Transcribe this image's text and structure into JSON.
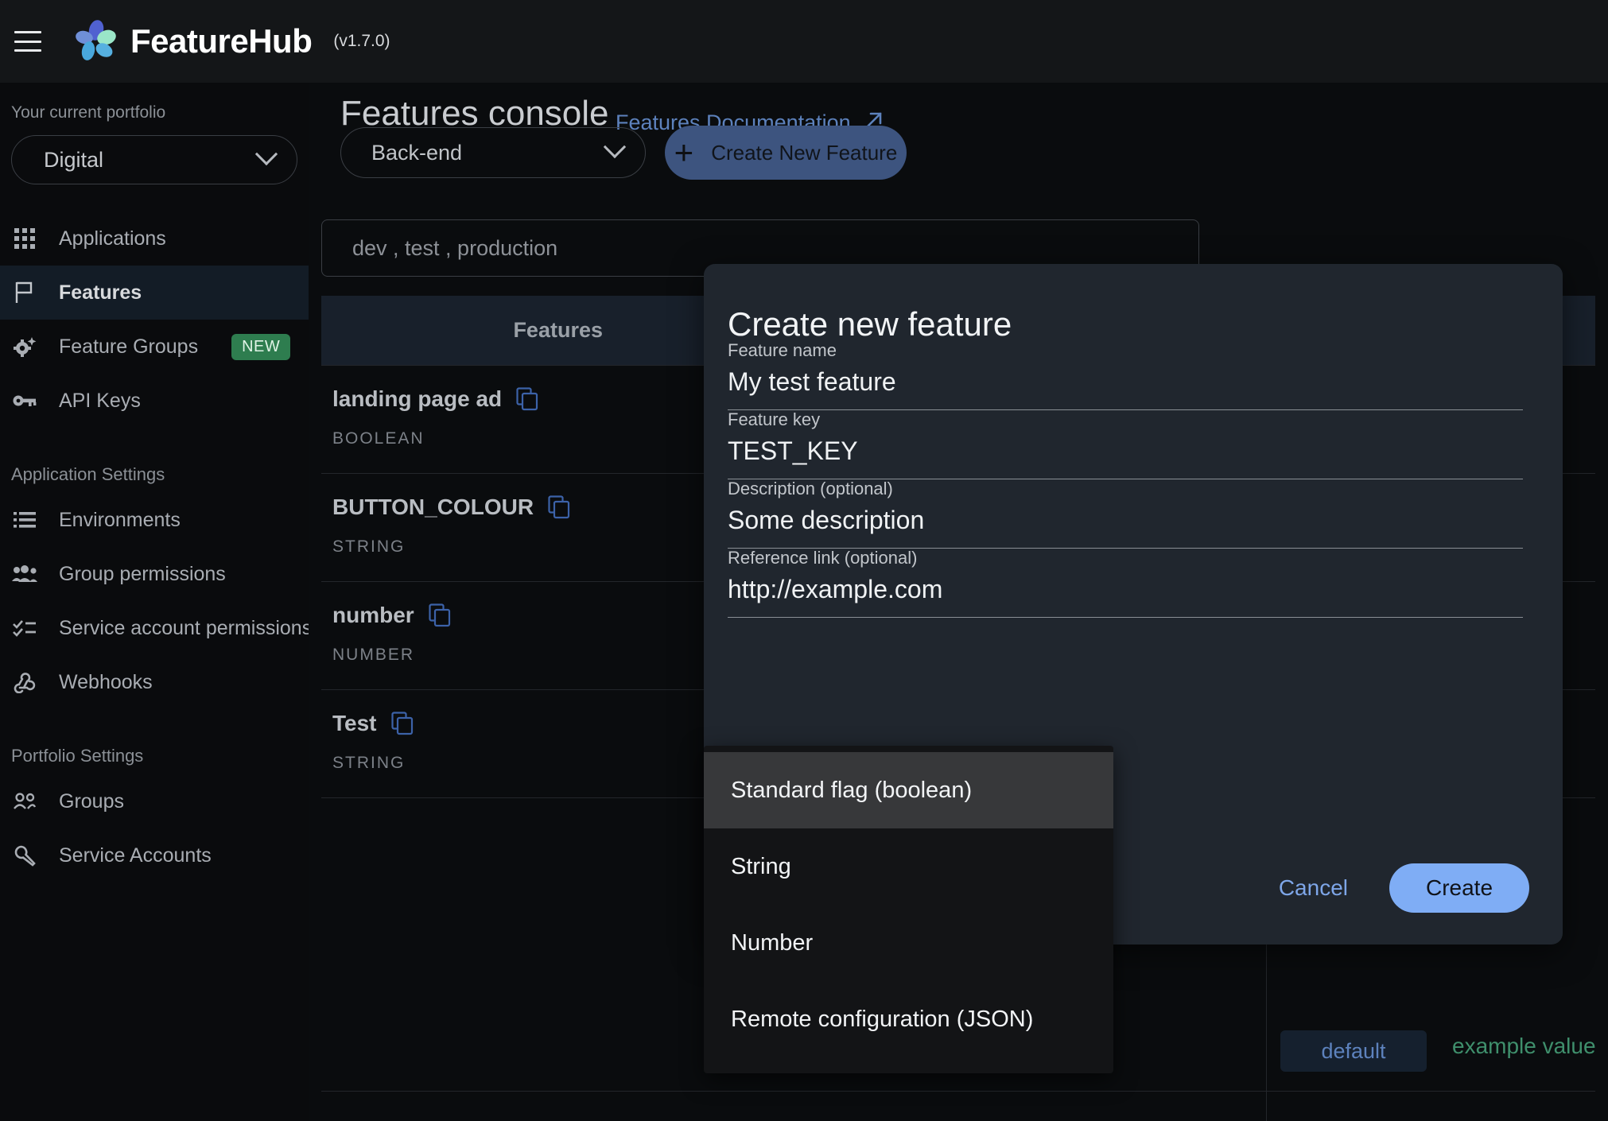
{
  "app": {
    "brand_name": "FeatureHub",
    "version": "(v1.7.0)",
    "menu_icon": "hamburger-icon",
    "logo_icon": "featurehub-flower-logo"
  },
  "sidebar": {
    "portfolio_label": "Your current portfolio",
    "portfolio_value": "Digital",
    "items": [
      {
        "label": "Applications",
        "icon": "apps-grid-icon",
        "active": false
      },
      {
        "label": "Features",
        "icon": "flag-icon",
        "active": true
      },
      {
        "label": "Feature Groups",
        "icon": "gear-sparkle-icon",
        "active": false,
        "badge": "NEW"
      },
      {
        "label": "API Keys",
        "icon": "key-icon",
        "active": false
      }
    ],
    "section_application_settings": "Application Settings",
    "application_items": [
      {
        "label": "Environments",
        "icon": "list-icon"
      },
      {
        "label": "Group permissions",
        "icon": "people-icon"
      },
      {
        "label": "Service account permissions",
        "icon": "checklist-icon"
      },
      {
        "label": "Webhooks",
        "icon": "webhook-icon"
      }
    ],
    "section_portfolio_settings": "Portfolio Settings",
    "portfolio_items": [
      {
        "label": "Groups",
        "icon": "group-icon"
      },
      {
        "label": "Service Accounts",
        "icon": "wrench-icon"
      }
    ]
  },
  "main": {
    "page_title": "Features console",
    "doc_link": "Features Documentation",
    "doc_link_icon": "external-link-arrow-icon",
    "environment_select": "Back-end",
    "create_button": "Create New Feature",
    "create_button_icon": "plus-icon",
    "search_placeholder": "dev , test , production",
    "table": {
      "header": "Features",
      "rows": [
        {
          "name": "landing page ad",
          "type": "BOOLEAN"
        },
        {
          "name": "BUTTON_COLOUR",
          "type": "STRING"
        },
        {
          "name": "number",
          "type": "NUMBER"
        },
        {
          "name": "Test",
          "type": "STRING"
        }
      ],
      "copy_icon": "copy-icon"
    },
    "background_chip": "default",
    "background_value": "example value"
  },
  "dialog": {
    "title": "Create new feature",
    "fields": [
      {
        "label": "Feature name",
        "value": "My test feature"
      },
      {
        "label": "Feature key",
        "value": "TEST_KEY"
      },
      {
        "label": "Description (optional)",
        "value": "Some description"
      },
      {
        "label": "Reference link (optional)",
        "value": "http://example.com"
      }
    ],
    "cancel_label": "Cancel",
    "create_label": "Create"
  },
  "dropdown": {
    "options": [
      {
        "label": "Standard flag (boolean)",
        "selected": true
      },
      {
        "label": "String",
        "selected": false
      },
      {
        "label": "Number",
        "selected": false
      },
      {
        "label": "Remote configuration (JSON)",
        "selected": false
      }
    ]
  },
  "colors": {
    "accent_blue": "#7fadf5",
    "link_blue": "#5d82bd",
    "badge_green": "#2e7d4f",
    "value_green": "#3f8f6c",
    "dialog_bg": "#20262e",
    "sidebar_bg": "#0a0b0d"
  }
}
